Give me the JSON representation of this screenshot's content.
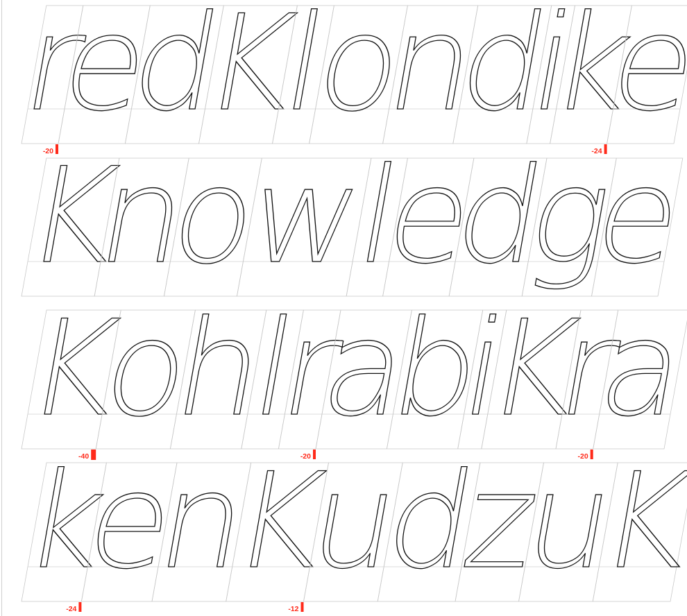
{
  "lines": [
    {
      "glyphs": [
        "r",
        "e",
        "d",
        "K",
        "l",
        "o",
        "n",
        "d",
        "i",
        "k",
        "e"
      ],
      "kerning": [
        {
          "after_glyph": 0,
          "value": "-20"
        },
        {
          "after_glyph": 9,
          "value": "-24"
        }
      ]
    },
    {
      "glyphs": [
        "K",
        "n",
        "o",
        "w",
        "l",
        "e",
        "d",
        "g",
        "e"
      ],
      "kerning": []
    },
    {
      "glyphs": [
        "K",
        "o",
        "h",
        "l",
        "r",
        "a",
        "b",
        "i",
        "K",
        "r",
        "a"
      ],
      "kerning": [
        {
          "after_glyph": 0,
          "value": "-40"
        },
        {
          "after_glyph": 4,
          "value": "-20"
        },
        {
          "after_glyph": 9,
          "value": "-20"
        }
      ]
    },
    {
      "glyphs": [
        "k",
        "e",
        "n",
        "K",
        "u",
        "d",
        "z",
        "u",
        "K"
      ],
      "kerning": [
        {
          "after_glyph": 0,
          "value": "-24"
        },
        {
          "after_glyph": 3,
          "value": "-12"
        }
      ]
    }
  ],
  "colors": {
    "glyph_stroke": "#111111",
    "cell_border": "#c8c8c8",
    "baseline": "#d0d0d0",
    "kern_marker": "#ff2a1a"
  }
}
